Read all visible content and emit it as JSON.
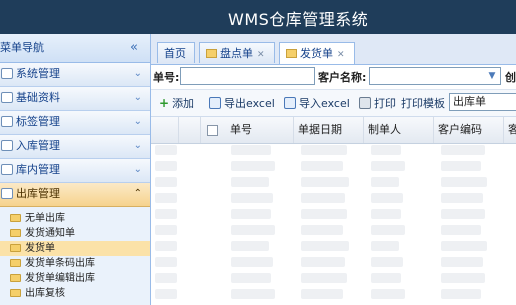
{
  "header": {
    "title": "WMS仓库管理系统"
  },
  "sidebar": {
    "title": "菜单导航",
    "collapse_glyph": "«",
    "menus": [
      {
        "label": "系统管理",
        "chev": "⌄"
      },
      {
        "label": "基础资料",
        "chev": "⌄"
      },
      {
        "label": "标签管理",
        "chev": "⌄"
      },
      {
        "label": "入库管理",
        "chev": "⌄"
      },
      {
        "label": "库内管理",
        "chev": "⌄"
      },
      {
        "label": "出库管理",
        "chev": "⌃"
      }
    ],
    "subitems": [
      {
        "label": "无单出库"
      },
      {
        "label": "发货通知单"
      },
      {
        "label": "发货单"
      },
      {
        "label": "发货单条码出库"
      },
      {
        "label": "发货单编辑出库"
      },
      {
        "label": "出库复核"
      }
    ]
  },
  "tabs": [
    {
      "label": "首页"
    },
    {
      "label": "盘点单",
      "close": "✕"
    },
    {
      "label": "发货单",
      "close": "✕"
    }
  ],
  "filter": {
    "order_no_label": "单号:",
    "order_no_value": "",
    "customer_label": "客户名称:",
    "customer_value": "",
    "create_label": "创"
  },
  "toolbar": {
    "add": "添加",
    "export": "导出excel",
    "import": "导入excel",
    "print": "打印",
    "template_label": "打印模板",
    "template_value": "出库单"
  },
  "grid": {
    "columns": [
      "单号",
      "单据日期",
      "制单人",
      "客户编码",
      "客"
    ]
  }
}
